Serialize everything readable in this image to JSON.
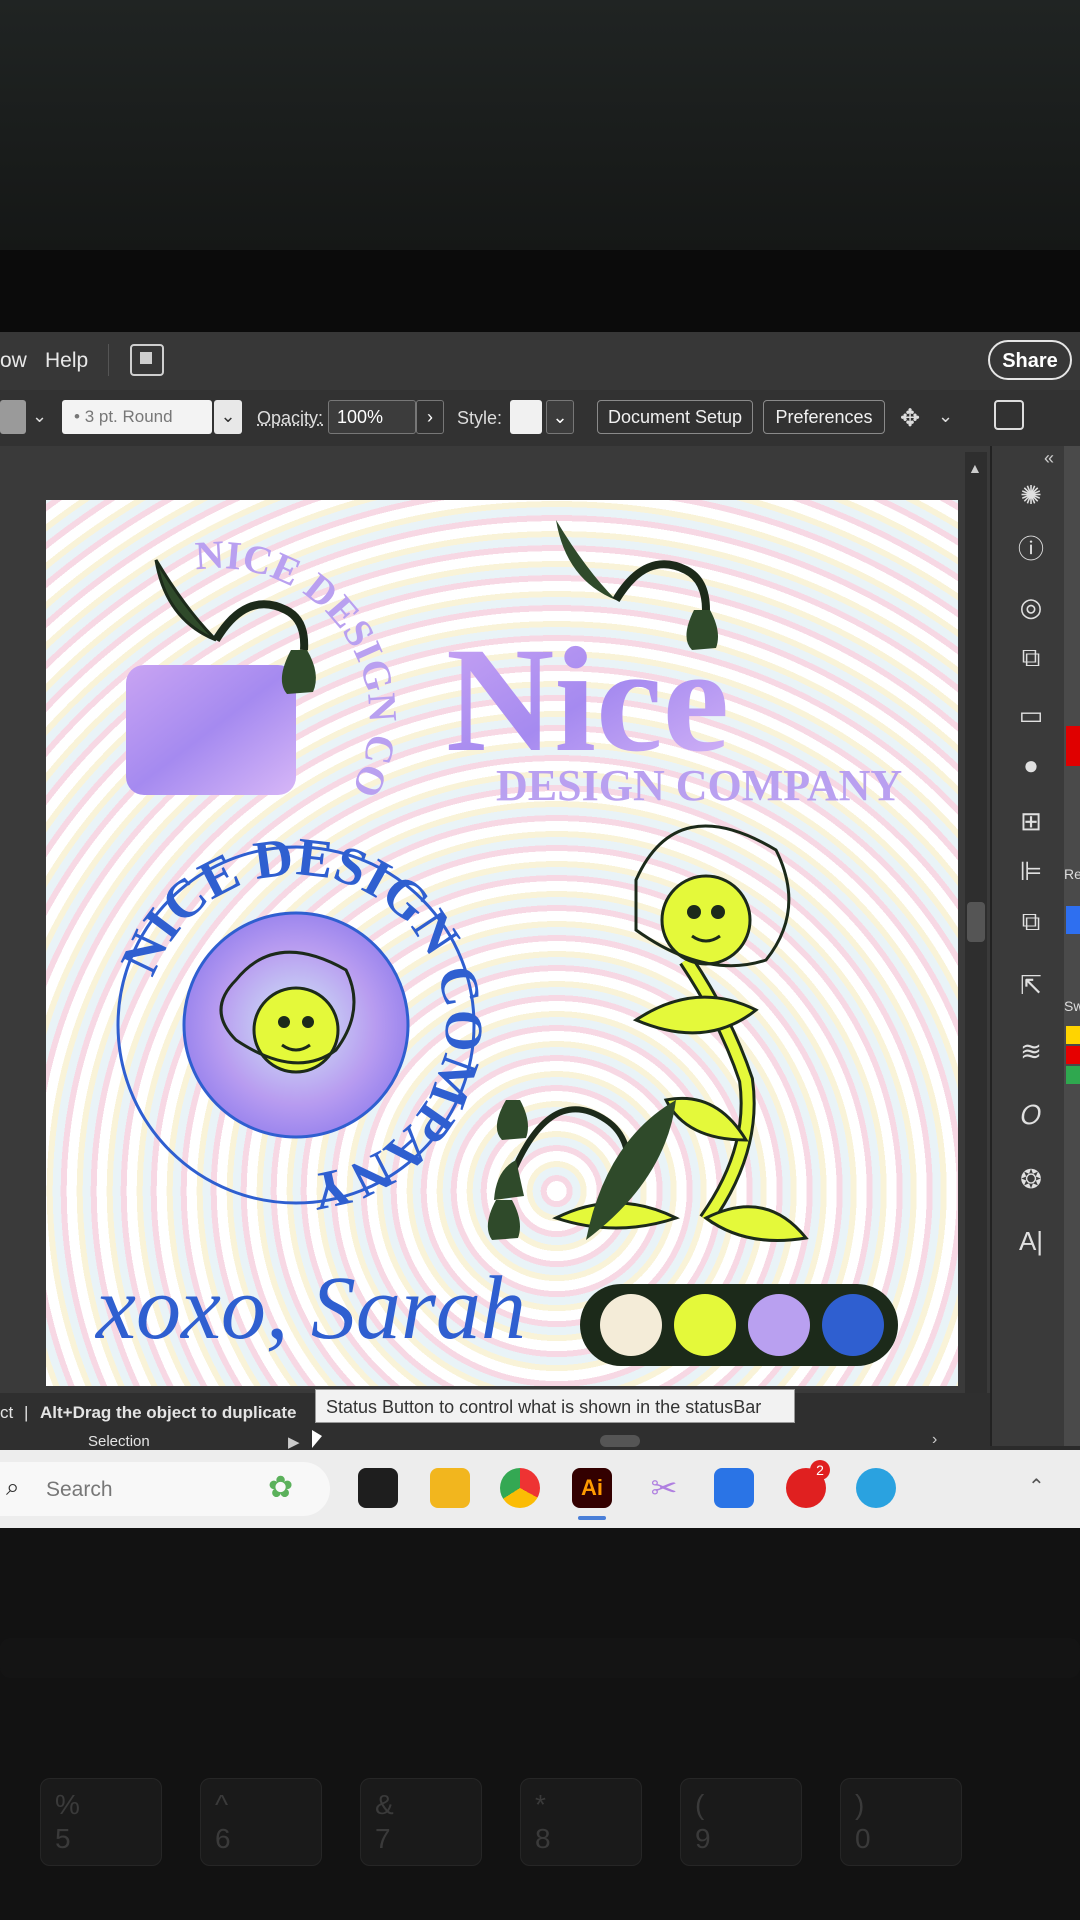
{
  "menubar": {
    "items": [
      "ow",
      "Help"
    ],
    "share_label": "Share"
  },
  "control_bar": {
    "stroke_value": "3 pt. Round",
    "opacity_label": "Opacity:",
    "opacity_value": "100%",
    "style_label": "Style:",
    "document_setup": "Document Setup",
    "preferences": "Preferences"
  },
  "artboard": {
    "logo_arc_text": "NICE DESIGN CO.",
    "nice_word": "Nice",
    "design_company": "DESIGN COMPANY",
    "badge_text": "NICE DESIGN COMPANY",
    "signature": "xoxo, Sarah",
    "swatch_colors": [
      "#f4ecd8",
      "#e4f93a",
      "#b9a0f0",
      "#2f5fd0"
    ]
  },
  "status": {
    "left_text": "ct",
    "hint": "Alt+Drag the object to duplicate",
    "tool": "Selection",
    "tooltip": "Status Button to control what is shown in the statusBar"
  },
  "right_panel": {
    "labels": [
      "Re",
      "Sw"
    ]
  },
  "taskbar": {
    "search_placeholder": "Search",
    "badge_count": "2"
  },
  "keyboard": {
    "keys": [
      "5",
      "6",
      "7",
      "8",
      "9",
      "0"
    ],
    "key_symbols": [
      "%",
      "^",
      "&",
      "*",
      "(",
      ")"
    ]
  }
}
